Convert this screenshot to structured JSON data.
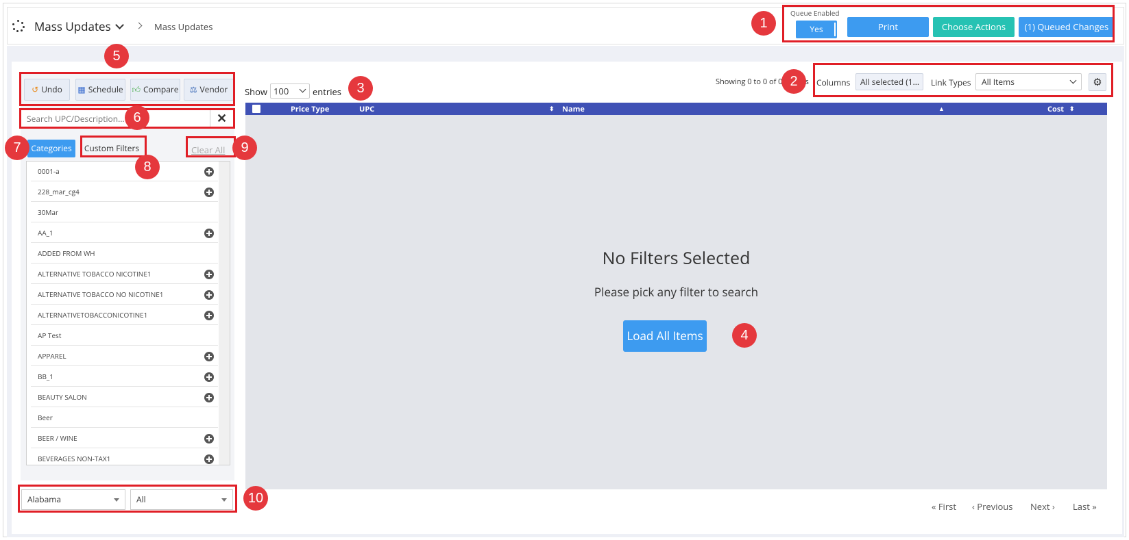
{
  "header": {
    "title": "Mass Updates",
    "breadcrumb": "Mass Updates",
    "queue_label": "Queue Enabled",
    "queue_value": "Yes",
    "print_label": "Print",
    "choose_actions_label": "Choose Actions",
    "queued_changes_label": "(1) Queued Changes"
  },
  "toolbar": {
    "undo_label": "Undo",
    "schedule_label": "Schedule",
    "compare_label": "Compare",
    "vendor_label": "Vendor"
  },
  "search": {
    "placeholder": "Search UPC/Description..."
  },
  "filters": {
    "categories_tab": "Categories",
    "custom_filters_tab": "Custom Filters",
    "clear_all": "Clear All"
  },
  "categories": [
    {
      "label": "0001-a",
      "expandable": true
    },
    {
      "label": "228_mar_cg4",
      "expandable": true
    },
    {
      "label": "30Mar",
      "expandable": false
    },
    {
      "label": "AA_1",
      "expandable": true
    },
    {
      "label": "ADDED FROM WH",
      "expandable": false
    },
    {
      "label": "ALTERNATIVE TOBACCO NICOTINE1",
      "expandable": true
    },
    {
      "label": "ALTERNATIVE TOBACCO NO NICOTINE1",
      "expandable": true
    },
    {
      "label": "ALTERNATIVETOBACCONICOTINE1",
      "expandable": true
    },
    {
      "label": "AP Test",
      "expandable": false
    },
    {
      "label": "APPAREL",
      "expandable": true
    },
    {
      "label": "BB_1",
      "expandable": true
    },
    {
      "label": "BEAUTY SALON",
      "expandable": true
    },
    {
      "label": "Beer",
      "expandable": false
    },
    {
      "label": "BEER / WINE",
      "expandable": true
    },
    {
      "label": "BEVERAGES NON-TAX1",
      "expandable": true
    }
  ],
  "bottom_selects": {
    "state": "Alabama",
    "store": "All"
  },
  "table_controls": {
    "show_label": "Show",
    "page_size": "100",
    "entries_label": "entries",
    "showing_text": "Showing 0 to 0 of 0 entries",
    "columns_label": "Columns",
    "columns_value": "All selected (1...",
    "link_types_label": "Link Types",
    "link_types_value": "All Items"
  },
  "table": {
    "columns": [
      "Price Type",
      "UPC",
      "Name",
      "Cost"
    ],
    "empty_title": "No Filters Selected",
    "empty_subtitle": "Please pick any filter to search",
    "load_all_label": "Load All Items"
  },
  "pagination": {
    "first": "First",
    "previous": "Previous",
    "next": "Next",
    "last": "Last"
  },
  "annotations": [
    "1",
    "2",
    "3",
    "4",
    "5",
    "6",
    "7",
    "8",
    "9",
    "10"
  ],
  "colors": {
    "primary_blue": "#3d9bf0",
    "teal": "#26c2b3",
    "table_header": "#3f51b5",
    "annotation_red": "#e01e26"
  }
}
